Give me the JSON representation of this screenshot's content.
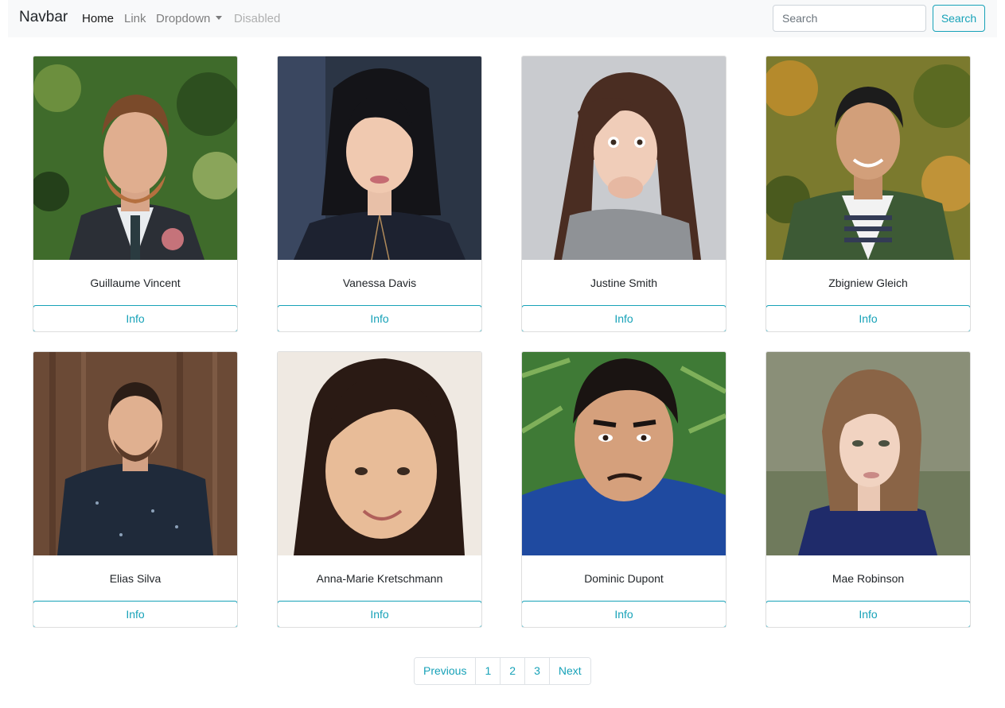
{
  "navbar": {
    "brand": "Navbar",
    "links": [
      {
        "label": "Home",
        "state": "active"
      },
      {
        "label": "Link",
        "state": "normal"
      },
      {
        "label": "Dropdown",
        "state": "normal"
      },
      {
        "label": "Disabled",
        "state": "disabled"
      }
    ],
    "search_placeholder": "Search",
    "search_button": "Search"
  },
  "cards": [
    {
      "name": "Guillaume Vincent",
      "button": "Info"
    },
    {
      "name": "Vanessa Davis",
      "button": "Info"
    },
    {
      "name": "Justine Smith",
      "button": "Info"
    },
    {
      "name": "Zbigniew Gleich",
      "button": "Info"
    },
    {
      "name": "Elias Silva",
      "button": "Info"
    },
    {
      "name": "Anna-Marie Kretschmann",
      "button": "Info"
    },
    {
      "name": "Dominic Dupont",
      "button": "Info"
    },
    {
      "name": "Mae Robinson",
      "button": "Info"
    }
  ],
  "pagination": {
    "previous": "Previous",
    "pages": [
      "1",
      "2",
      "3"
    ],
    "next": "Next"
  },
  "colors": {
    "accent": "#17a2b8",
    "navbar_bg": "#f8f9fa"
  }
}
